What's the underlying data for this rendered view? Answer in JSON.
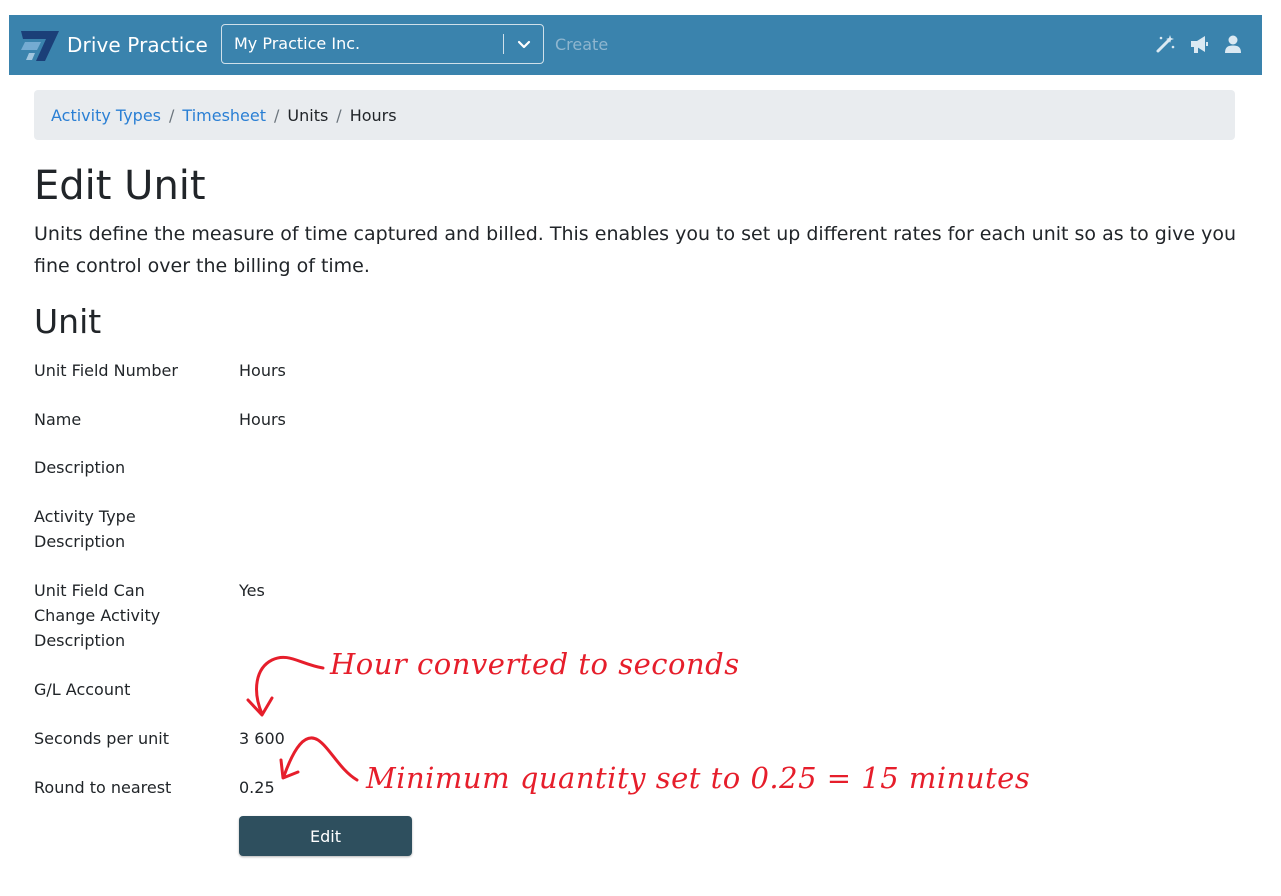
{
  "brand": {
    "name": "Drive Practice",
    "icon": "drive-practice-logo"
  },
  "practice_select": {
    "value": "My Practice Inc.",
    "icon": "chevron-down-icon"
  },
  "nav": {
    "create_label": "Create",
    "icons": [
      "magic-wand-icon",
      "megaphone-icon",
      "user-icon"
    ]
  },
  "breadcrumb": [
    {
      "label": "Activity Types",
      "link": true
    },
    {
      "label": "Timesheet",
      "link": true
    },
    {
      "label": "Units",
      "link": false
    },
    {
      "label": "Hours",
      "link": false
    }
  ],
  "page": {
    "title": "Edit Unit",
    "intro": "Units define the measure of time captured and billed. This enables you to set up different rates for each unit so as to give you fine control over the billing of time.",
    "section_title": "Unit"
  },
  "fields": [
    {
      "label": "Unit Field Number",
      "value": "Hours"
    },
    {
      "label": "Name",
      "value": "Hours"
    },
    {
      "label": "Description",
      "value": ""
    },
    {
      "label": "Activity Type Description",
      "value": ""
    },
    {
      "label": "Unit Field Can Change Activity Description",
      "value": "Yes"
    },
    {
      "label": "G/L Account",
      "value": ""
    },
    {
      "label": "Seconds per unit",
      "value": "3 600"
    },
    {
      "label": "Round to nearest",
      "value": "0.25"
    }
  ],
  "edit_button_label": "Edit",
  "annotations": {
    "color": "#e61e2b",
    "seconds_note": "Hour converted to seconds",
    "rounding_note": "Minimum quantity set to 0.25 = 15 minutes"
  },
  "colors": {
    "navbar": "#3a83ad",
    "link": "#2a7fd4",
    "button": "#2e4f5e",
    "breadcrumb_bg": "#e9ecef"
  }
}
